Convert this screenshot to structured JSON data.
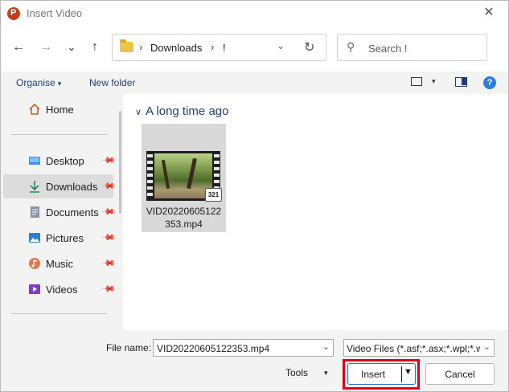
{
  "window": {
    "title": "Insert Video",
    "close_glyph": "✕"
  },
  "nav": {
    "back_glyph": "←",
    "forward_glyph": "→",
    "recent_glyph": "⌄",
    "up_glyph": "↑"
  },
  "address": {
    "sep1": "›",
    "crumb1": "Downloads",
    "sep2": "›",
    "crumb2": "!",
    "dropdown_glyph": "⌄",
    "refresh_glyph": "↻"
  },
  "search": {
    "placeholder": "Search !",
    "icon_glyph": "⚲"
  },
  "toolbar": {
    "organise_label": "Organise",
    "caret": "▾",
    "new_folder_label": "New folder",
    "view_caret": "▾",
    "help_glyph": "?"
  },
  "sidebar": {
    "pin_glyph": "📌",
    "items": [
      {
        "label": "Home",
        "icon": "home-icon"
      },
      {
        "label": "Desktop",
        "icon": "desktop-icon"
      },
      {
        "label": "Downloads",
        "icon": "download-icon"
      },
      {
        "label": "Documents",
        "icon": "documents-icon"
      },
      {
        "label": "Pictures",
        "icon": "pictures-icon"
      },
      {
        "label": "Music",
        "icon": "music-icon"
      },
      {
        "label": "Videos",
        "icon": "videos-icon"
      }
    ]
  },
  "content": {
    "group_chevron": "∨",
    "group_title": "A long time ago",
    "file": {
      "name": "VID20220605122353.mp4",
      "badge": "321"
    }
  },
  "footer": {
    "file_name_label": "File name:",
    "file_name_value": "VID20220605122353.mp4",
    "file_type_value": "Video Files (*.asf;*.asx;*.wpl;*.w",
    "dropdown_glyph": "⌄",
    "tools_label": "Tools",
    "tools_caret": "▾",
    "insert_label": "Insert",
    "insert_caret": "▼",
    "cancel_label": "Cancel"
  },
  "colors": {
    "accent": "#1f3d7a",
    "highlight": "#e0001b",
    "selected_bg": "#dcdcdc",
    "panel_bg": "#f3f3f3"
  }
}
